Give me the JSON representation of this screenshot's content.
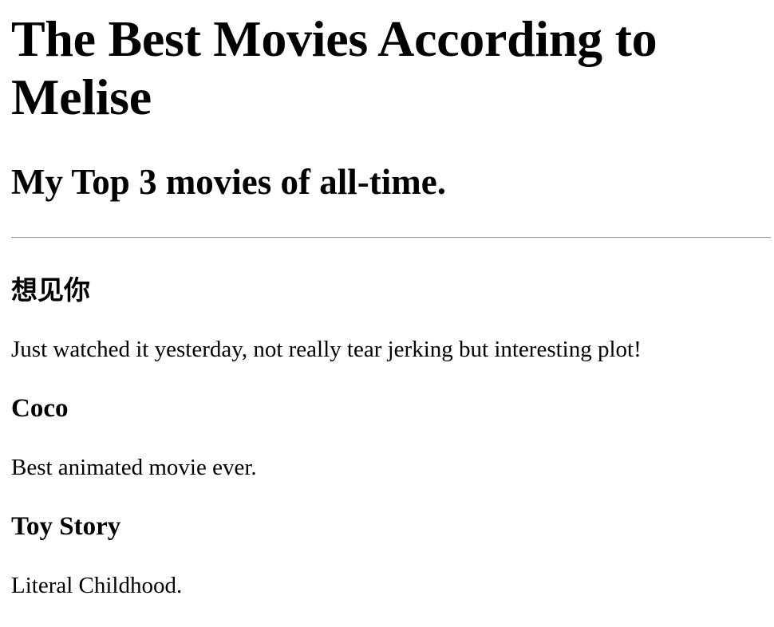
{
  "page": {
    "title": "The Best Movies According to Melise",
    "subtitle": "My Top 3 movies of all-time."
  },
  "movies": [
    {
      "title": "想见你",
      "description": "Just watched it yesterday, not really tear jerking but interesting plot!"
    },
    {
      "title": "Coco",
      "description": "Best animated movie ever."
    },
    {
      "title": "Toy Story",
      "description": "Literal Childhood."
    }
  ]
}
